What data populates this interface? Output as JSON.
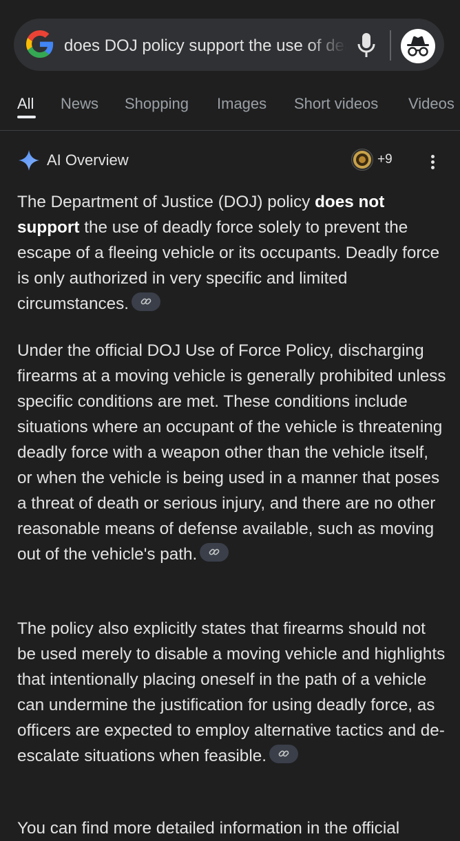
{
  "search": {
    "query": "does DOJ policy support the use of deadly force",
    "icons": [
      "google-g-icon",
      "mic-icon",
      "incognito-icon"
    ]
  },
  "tabs": [
    {
      "label": "All",
      "active": true
    },
    {
      "label": "News"
    },
    {
      "label": "Shopping"
    },
    {
      "label": "Images"
    },
    {
      "label": "Short videos"
    },
    {
      "label": "Videos"
    }
  ],
  "ai_overview": {
    "title": "AI Overview",
    "source_count": "+9",
    "p1": {
      "before": "The Department of Justice (DOJ) policy ",
      "bold": "does not support",
      "after": " the use of deadly force solely to prevent the escape of a fleeing vehicle or its occupants. Deadly force is only authorized in very specific and limited circumstances."
    },
    "p2": "Under the official DOJ Use of Force Policy, discharging firearms at a moving vehicle is generally prohibited unless specific conditions are met. These conditions include situations where an occupant of the vehicle is threatening deadly force with a weapon other than the vehicle itself, or when the vehicle is being used in a manner that poses a threat of death or serious injury, and there are no other reasonable means of defense available, such as moving out of the vehicle's path.",
    "p3": "The policy also explicitly states that firearms should not be used merely to disable a moving vehicle and highlights that intentionally placing oneself in the path of a vehicle can undermine the justification for using deadly force, as officers are expected to employ alternative tactics and de-escalate situations when feasible.",
    "p4_partial": "You can find more detailed information in the official"
  },
  "colors": {
    "background": "#1f1f1f",
    "search_bar": "#303134",
    "text": "#e3e3e3",
    "muted_tab": "#9aa0a6",
    "link_chip": "#3a3f4a"
  }
}
